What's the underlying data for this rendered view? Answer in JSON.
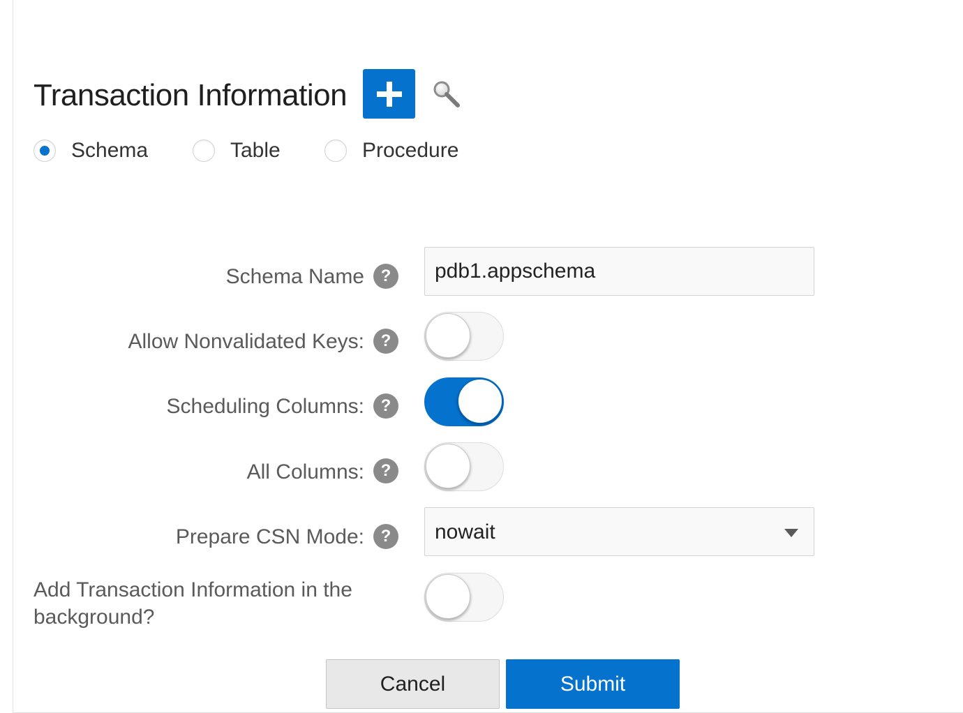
{
  "header": {
    "title": "Transaction Information",
    "add_icon": "plus-icon",
    "search_icon": "magnifier-icon"
  },
  "object_type": {
    "selected": "Schema",
    "options": [
      {
        "label": "Schema",
        "checked": true
      },
      {
        "label": "Table",
        "checked": false
      },
      {
        "label": "Procedure",
        "checked": false
      }
    ]
  },
  "form": {
    "schema_name": {
      "label": "Schema Name",
      "value": "pdb1.appschema"
    },
    "allow_nonvalidated_keys": {
      "label": "Allow Nonvalidated Keys:",
      "on": false
    },
    "scheduling_columns": {
      "label": "Scheduling Columns:",
      "on": true
    },
    "all_columns": {
      "label": "All Columns:",
      "on": false
    },
    "prepare_csn_mode": {
      "label": "Prepare CSN Mode:",
      "value": "nowait"
    },
    "background": {
      "label": "Add Transaction Information in the background?",
      "on": false
    },
    "help_glyph": "?"
  },
  "actions": {
    "cancel_label": "Cancel",
    "submit_label": "Submit"
  },
  "colors": {
    "accent": "#0572ce",
    "help_icon": "#8a8a8a",
    "label_text": "#5a5a5a"
  }
}
